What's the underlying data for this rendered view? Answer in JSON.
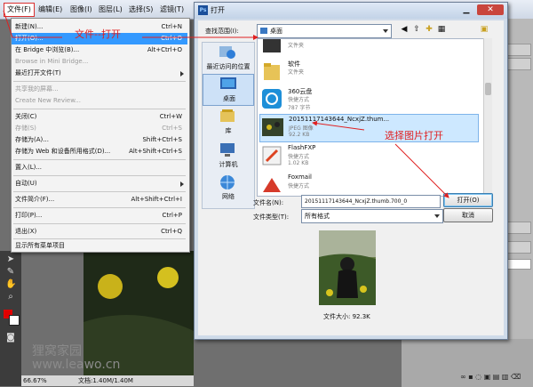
{
  "menubar": {
    "items": [
      "文件(F)",
      "编辑(E)",
      "图像(I)",
      "图层(L)",
      "选择(S)",
      "滤镜(T)"
    ]
  },
  "file_menu": {
    "items": [
      {
        "label": "新建(N)...",
        "shortcut": "Ctrl+N"
      },
      {
        "label": "打开(O)...",
        "shortcut": "Ctrl+O"
      },
      {
        "label": "在 Bridge 中浏览(B)...",
        "shortcut": "Alt+Ctrl+O"
      },
      {
        "label": "Browse in Mini Bridge...",
        "shortcut": ""
      },
      {
        "label": "最近打开文件(T)",
        "shortcut": ""
      },
      {
        "label": "共享我的屏幕...",
        "shortcut": ""
      },
      {
        "label": "Create New Review...",
        "shortcut": ""
      },
      {
        "label": "关闭(C)",
        "shortcut": "Ctrl+W"
      },
      {
        "label": "存储(S)",
        "shortcut": "Ctrl+S"
      },
      {
        "label": "存储为(A)...",
        "shortcut": "Shift+Ctrl+S"
      },
      {
        "label": "存储为 Web 和设备所用格式(D)...",
        "shortcut": "Alt+Shift+Ctrl+S"
      },
      {
        "label": "置入(L)...",
        "shortcut": ""
      },
      {
        "label": "自动(U)",
        "shortcut": ""
      },
      {
        "label": "文件简介(F)...",
        "shortcut": "Alt+Shift+Ctrl+I"
      },
      {
        "label": "打印(P)...",
        "shortcut": "Ctrl+P"
      },
      {
        "label": "退出(X)",
        "shortcut": "Ctrl+Q"
      },
      {
        "label": "显示所有菜单项目",
        "shortcut": ""
      }
    ]
  },
  "dialog": {
    "title": "打开",
    "look_in_label": "查找范围(I):",
    "look_in_value": "桌面",
    "places": [
      "最近访问的位置",
      "桌面",
      "库",
      "计算机",
      "网络"
    ],
    "files": [
      {
        "name": "",
        "type": "文件夹",
        "size": ""
      },
      {
        "name": "软件",
        "type": "文件夹",
        "size": ""
      },
      {
        "name": "360云盘",
        "type": "快捷方式",
        "size": "787 字节"
      },
      {
        "name": "20151117143644_NcxjZ.thum...",
        "type": "JPEG 图像",
        "size": "92.2 KB"
      },
      {
        "name": "FlashFXP",
        "type": "快捷方式",
        "size": "1.02 KB"
      },
      {
        "name": "Foxmail",
        "type": "快捷方式",
        "size": ""
      }
    ],
    "filename_label": "文件名(N):",
    "filename_value": "20151117143644_NcxjZ.thumb.700_0",
    "filetype_label": "文件类型(T):",
    "filetype_value": "所有格式",
    "open_label": "打开(O)",
    "cancel_label": "取消",
    "preview_size": "文件大小: 92.3K"
  },
  "status": {
    "zoom": "66.67%",
    "doc": "文档:1.40M/1.40M"
  },
  "annotations": {
    "open_hint": "文件--打开",
    "select_hint": "选择图片打开"
  },
  "watermark": {
    "line1": "狸窝家园",
    "line2": "www.leawo.cn"
  },
  "colors": {
    "annotation": "#e02020",
    "highlight": "#3399ff"
  }
}
